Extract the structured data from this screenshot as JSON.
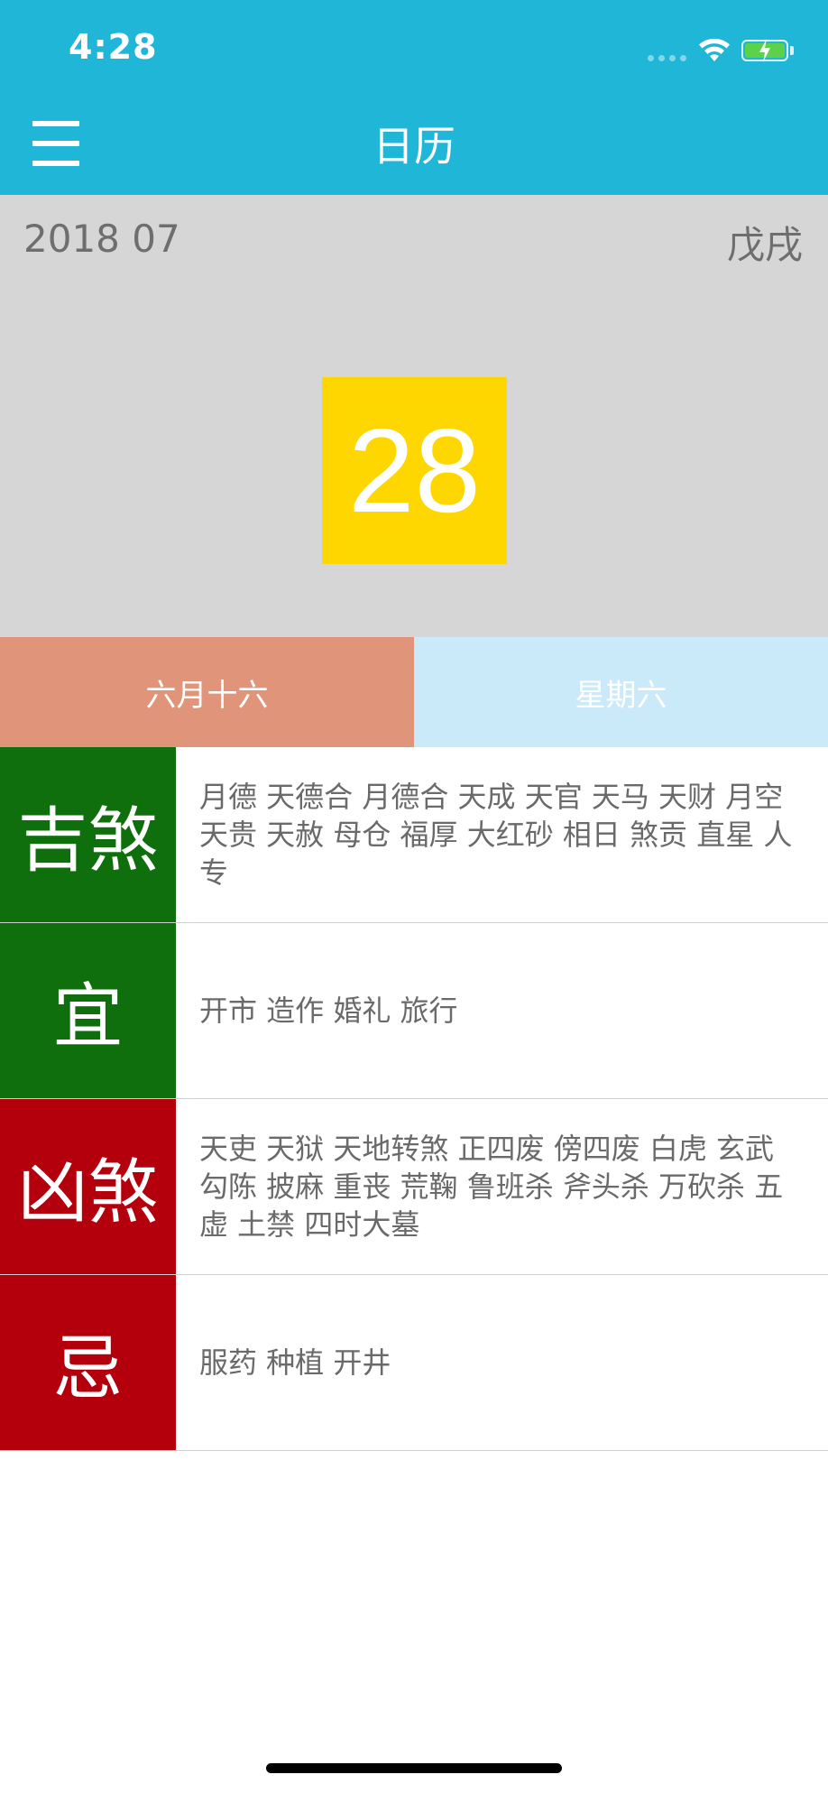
{
  "status_bar": {
    "time": "4:28"
  },
  "nav": {
    "title": "日历",
    "menu_icon": "hamburger-menu-icon"
  },
  "date_header": {
    "year_month": "2018 07",
    "ganzhi": "戊戌",
    "day": "28"
  },
  "info_row": {
    "lunar_date": "六月十六",
    "weekday": "星期六"
  },
  "rows": [
    {
      "label": "吉煞",
      "content": "月德 天德合 月德合 天成 天官 天马 天财 月空 天贵 天赦 母仓 福厚 大红砂 相日 煞贡 直星 人专"
    },
    {
      "label": "宜",
      "content": "开市 造作 婚礼 旅行"
    },
    {
      "label": "凶煞",
      "content": "天吏 天狱 天地转煞 正四废 傍四废 白虎 玄武 勾陈 披麻 重丧 荒鞠 鲁班杀 斧头杀 万砍杀 五虚 土禁 四时大墓"
    },
    {
      "label": "忌",
      "content": "服药 种植 开井"
    }
  ],
  "colors": {
    "header": "#20b6d8",
    "date_region": "#d6d6d6",
    "day_box": "#ffd700",
    "lunar_cell": "#e0957b",
    "weekday_cell": "#cbeaf9",
    "auspicious": "#0f6f0c",
    "inauspicious": "#b3000c"
  }
}
